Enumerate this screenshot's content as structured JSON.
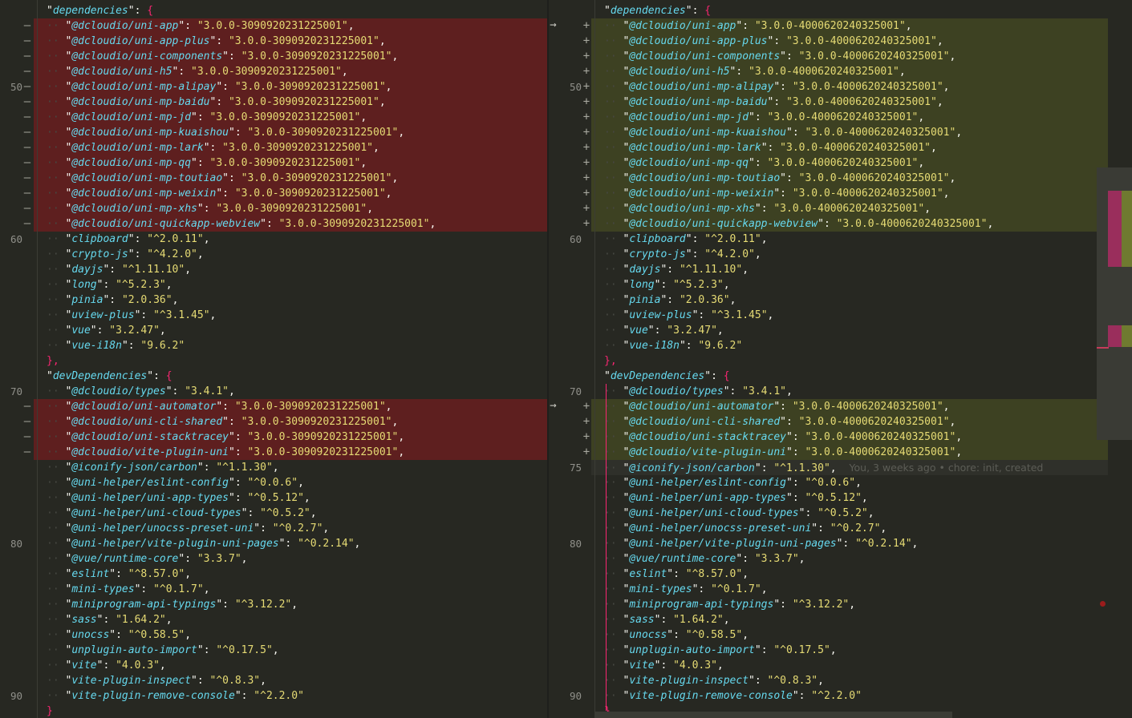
{
  "editor": {
    "colors": {
      "removed_bg": "#5e1f1f",
      "added_bg": "#3d4122",
      "key": "#66d9ef",
      "string": "#e6db74",
      "bracket": "#f92672"
    },
    "blame": "You, 3 weeks ago • chore: init, created",
    "left_lines": [
      {
        "num": "",
        "mark": "",
        "indent": 1,
        "type": "ctx",
        "key": "dependencies",
        "value": "",
        "tail": ": {",
        "brace": true
      },
      {
        "num": "",
        "mark": "—",
        "indent": 2,
        "type": "removed",
        "key": "@dcloudio/uni-app",
        "value": "3.0.0-3090920231225001",
        "tail": ","
      },
      {
        "num": "",
        "mark": "—",
        "indent": 2,
        "type": "removed",
        "key": "@dcloudio/uni-app-plus",
        "value": "3.0.0-3090920231225001",
        "tail": ","
      },
      {
        "num": "",
        "mark": "—",
        "indent": 2,
        "type": "removed",
        "key": "@dcloudio/uni-components",
        "value": "3.0.0-3090920231225001",
        "tail": ","
      },
      {
        "num": "",
        "mark": "—",
        "indent": 2,
        "type": "removed",
        "key": "@dcloudio/uni-h5",
        "value": "3.0.0-3090920231225001",
        "tail": ","
      },
      {
        "num": "50",
        "mark": "—",
        "indent": 2,
        "type": "removed",
        "key": "@dcloudio/uni-mp-alipay",
        "value": "3.0.0-3090920231225001",
        "tail": ","
      },
      {
        "num": "",
        "mark": "—",
        "indent": 2,
        "type": "removed",
        "key": "@dcloudio/uni-mp-baidu",
        "value": "3.0.0-3090920231225001",
        "tail": ","
      },
      {
        "num": "",
        "mark": "—",
        "indent": 2,
        "type": "removed",
        "key": "@dcloudio/uni-mp-jd",
        "value": "3.0.0-3090920231225001",
        "tail": ","
      },
      {
        "num": "",
        "mark": "—",
        "indent": 2,
        "type": "removed",
        "key": "@dcloudio/uni-mp-kuaishou",
        "value": "3.0.0-3090920231225001",
        "tail": ","
      },
      {
        "num": "",
        "mark": "—",
        "indent": 2,
        "type": "removed",
        "key": "@dcloudio/uni-mp-lark",
        "value": "3.0.0-3090920231225001",
        "tail": ","
      },
      {
        "num": "",
        "mark": "—",
        "indent": 2,
        "type": "removed",
        "key": "@dcloudio/uni-mp-qq",
        "value": "3.0.0-3090920231225001",
        "tail": ","
      },
      {
        "num": "",
        "mark": "—",
        "indent": 2,
        "type": "removed",
        "key": "@dcloudio/uni-mp-toutiao",
        "value": "3.0.0-3090920231225001",
        "tail": ","
      },
      {
        "num": "",
        "mark": "—",
        "indent": 2,
        "type": "removed",
        "key": "@dcloudio/uni-mp-weixin",
        "value": "3.0.0-3090920231225001",
        "tail": ","
      },
      {
        "num": "",
        "mark": "—",
        "indent": 2,
        "type": "removed",
        "key": "@dcloudio/uni-mp-xhs",
        "value": "3.0.0-3090920231225001",
        "tail": ","
      },
      {
        "num": "",
        "mark": "—",
        "indent": 2,
        "type": "removed",
        "key": "@dcloudio/uni-quickapp-webview",
        "value": "3.0.0-3090920231225001",
        "tail": ","
      },
      {
        "num": "60",
        "mark": "",
        "indent": 2,
        "type": "ctx",
        "key": "clipboard",
        "value": "^2.0.11",
        "tail": ","
      },
      {
        "num": "",
        "mark": "",
        "indent": 2,
        "type": "ctx",
        "key": "crypto-js",
        "value": "^4.2.0",
        "tail": ","
      },
      {
        "num": "",
        "mark": "",
        "indent": 2,
        "type": "ctx",
        "key": "dayjs",
        "value": "^1.11.10",
        "tail": ","
      },
      {
        "num": "",
        "mark": "",
        "indent": 2,
        "type": "ctx",
        "key": "long",
        "value": "^5.2.3",
        "tail": ","
      },
      {
        "num": "",
        "mark": "",
        "indent": 2,
        "type": "ctx",
        "key": "pinia",
        "value": "2.0.36",
        "tail": ","
      },
      {
        "num": "",
        "mark": "",
        "indent": 2,
        "type": "ctx",
        "key": "uview-plus",
        "value": "^3.1.45",
        "tail": ","
      },
      {
        "num": "",
        "mark": "",
        "indent": 2,
        "type": "ctx",
        "key": "vue",
        "value": "3.2.47",
        "tail": ","
      },
      {
        "num": "",
        "mark": "",
        "indent": 2,
        "type": "ctx",
        "key": "vue-i18n",
        "value": "9.6.2",
        "tail": ""
      },
      {
        "num": "",
        "mark": "",
        "indent": 1,
        "type": "ctx",
        "key": "",
        "value": "",
        "tail": "},",
        "close": true
      },
      {
        "num": "",
        "mark": "",
        "indent": 1,
        "type": "ctx",
        "key": "devDependencies",
        "value": "",
        "tail": ": {",
        "brace": true
      },
      {
        "num": "70",
        "mark": "",
        "indent": 2,
        "type": "ctx",
        "key": "@dcloudio/types",
        "value": "3.4.1",
        "tail": ","
      },
      {
        "num": "",
        "mark": "—",
        "indent": 2,
        "type": "removed",
        "key": "@dcloudio/uni-automator",
        "value": "3.0.0-3090920231225001",
        "tail": ","
      },
      {
        "num": "",
        "mark": "—",
        "indent": 2,
        "type": "removed",
        "key": "@dcloudio/uni-cli-shared",
        "value": "3.0.0-3090920231225001",
        "tail": ","
      },
      {
        "num": "",
        "mark": "—",
        "indent": 2,
        "type": "removed",
        "key": "@dcloudio/uni-stacktracey",
        "value": "3.0.0-3090920231225001",
        "tail": ","
      },
      {
        "num": "",
        "mark": "—",
        "indent": 2,
        "type": "removed",
        "key": "@dcloudio/vite-plugin-uni",
        "value": "3.0.0-3090920231225001",
        "tail": ","
      },
      {
        "num": "",
        "mark": "",
        "indent": 2,
        "type": "ctx",
        "key": "@iconify-json/carbon",
        "value": "^1.1.30",
        "tail": ","
      },
      {
        "num": "",
        "mark": "",
        "indent": 2,
        "type": "ctx",
        "key": "@uni-helper/eslint-config",
        "value": "^0.0.6",
        "tail": ","
      },
      {
        "num": "",
        "mark": "",
        "indent": 2,
        "type": "ctx",
        "key": "@uni-helper/uni-app-types",
        "value": "^0.5.12",
        "tail": ","
      },
      {
        "num": "",
        "mark": "",
        "indent": 2,
        "type": "ctx",
        "key": "@uni-helper/uni-cloud-types",
        "value": "^0.5.2",
        "tail": ","
      },
      {
        "num": "",
        "mark": "",
        "indent": 2,
        "type": "ctx",
        "key": "@uni-helper/unocss-preset-uni",
        "value": "^0.2.7",
        "tail": ","
      },
      {
        "num": "80",
        "mark": "",
        "indent": 2,
        "type": "ctx",
        "key": "@uni-helper/vite-plugin-uni-pages",
        "value": "^0.2.14",
        "tail": ","
      },
      {
        "num": "",
        "mark": "",
        "indent": 2,
        "type": "ctx",
        "key": "@vue/runtime-core",
        "value": "3.3.7",
        "tail": ","
      },
      {
        "num": "",
        "mark": "",
        "indent": 2,
        "type": "ctx",
        "key": "eslint",
        "value": "^8.57.0",
        "tail": ","
      },
      {
        "num": "",
        "mark": "",
        "indent": 2,
        "type": "ctx",
        "key": "mini-types",
        "value": "^0.1.7",
        "tail": ","
      },
      {
        "num": "",
        "mark": "",
        "indent": 2,
        "type": "ctx",
        "key": "miniprogram-api-typings",
        "value": "^3.12.2",
        "tail": ","
      },
      {
        "num": "",
        "mark": "",
        "indent": 2,
        "type": "ctx",
        "key": "sass",
        "value": "1.64.2",
        "tail": ","
      },
      {
        "num": "",
        "mark": "",
        "indent": 2,
        "type": "ctx",
        "key": "unocss",
        "value": "^0.58.5",
        "tail": ","
      },
      {
        "num": "",
        "mark": "",
        "indent": 2,
        "type": "ctx",
        "key": "unplugin-auto-import",
        "value": "^0.17.5",
        "tail": ","
      },
      {
        "num": "",
        "mark": "",
        "indent": 2,
        "type": "ctx",
        "key": "vite",
        "value": "4.0.3",
        "tail": ","
      },
      {
        "num": "",
        "mark": "",
        "indent": 2,
        "type": "ctx",
        "key": "vite-plugin-inspect",
        "value": "^0.8.3",
        "tail": ","
      },
      {
        "num": "90",
        "mark": "",
        "indent": 2,
        "type": "ctx",
        "key": "vite-plugin-remove-console",
        "value": "^2.2.0",
        "tail": ""
      },
      {
        "num": "",
        "mark": "",
        "indent": 1,
        "type": "ctx",
        "key": "",
        "value": "",
        "tail": "}",
        "close": true
      }
    ],
    "right_lines": [
      {
        "num": "",
        "mark": "",
        "indent": 1,
        "type": "ctx",
        "key": "dependencies",
        "value": "",
        "tail": ": {",
        "brace": true
      },
      {
        "num": "",
        "mark": "+",
        "indent": 2,
        "type": "added",
        "key": "@dcloudio/uni-app",
        "value": "3.0.0-4000620240325001",
        "tail": ","
      },
      {
        "num": "",
        "mark": "+",
        "indent": 2,
        "type": "added",
        "key": "@dcloudio/uni-app-plus",
        "value": "3.0.0-4000620240325001",
        "tail": ","
      },
      {
        "num": "",
        "mark": "+",
        "indent": 2,
        "type": "added",
        "key": "@dcloudio/uni-components",
        "value": "3.0.0-4000620240325001",
        "tail": ","
      },
      {
        "num": "",
        "mark": "+",
        "indent": 2,
        "type": "added",
        "key": "@dcloudio/uni-h5",
        "value": "3.0.0-4000620240325001",
        "tail": ","
      },
      {
        "num": "50",
        "mark": "+",
        "indent": 2,
        "type": "added",
        "key": "@dcloudio/uni-mp-alipay",
        "value": "3.0.0-4000620240325001",
        "tail": ","
      },
      {
        "num": "",
        "mark": "+",
        "indent": 2,
        "type": "added",
        "key": "@dcloudio/uni-mp-baidu",
        "value": "3.0.0-4000620240325001",
        "tail": ","
      },
      {
        "num": "",
        "mark": "+",
        "indent": 2,
        "type": "added",
        "key": "@dcloudio/uni-mp-jd",
        "value": "3.0.0-4000620240325001",
        "tail": ","
      },
      {
        "num": "",
        "mark": "+",
        "indent": 2,
        "type": "added",
        "key": "@dcloudio/uni-mp-kuaishou",
        "value": "3.0.0-4000620240325001",
        "tail": ","
      },
      {
        "num": "",
        "mark": "+",
        "indent": 2,
        "type": "added",
        "key": "@dcloudio/uni-mp-lark",
        "value": "3.0.0-4000620240325001",
        "tail": ","
      },
      {
        "num": "",
        "mark": "+",
        "indent": 2,
        "type": "added",
        "key": "@dcloudio/uni-mp-qq",
        "value": "3.0.0-4000620240325001",
        "tail": ","
      },
      {
        "num": "",
        "mark": "+",
        "indent": 2,
        "type": "added",
        "key": "@dcloudio/uni-mp-toutiao",
        "value": "3.0.0-4000620240325001",
        "tail": ","
      },
      {
        "num": "",
        "mark": "+",
        "indent": 2,
        "type": "added",
        "key": "@dcloudio/uni-mp-weixin",
        "value": "3.0.0-4000620240325001",
        "tail": ","
      },
      {
        "num": "",
        "mark": "+",
        "indent": 2,
        "type": "added",
        "key": "@dcloudio/uni-mp-xhs",
        "value": "3.0.0-4000620240325001",
        "tail": ","
      },
      {
        "num": "",
        "mark": "+",
        "indent": 2,
        "type": "added",
        "key": "@dcloudio/uni-quickapp-webview",
        "value": "3.0.0-4000620240325001",
        "tail": ","
      },
      {
        "num": "60",
        "mark": "",
        "indent": 2,
        "type": "ctx",
        "key": "clipboard",
        "value": "^2.0.11",
        "tail": ","
      },
      {
        "num": "",
        "mark": "",
        "indent": 2,
        "type": "ctx",
        "key": "crypto-js",
        "value": "^4.2.0",
        "tail": ","
      },
      {
        "num": "",
        "mark": "",
        "indent": 2,
        "type": "ctx",
        "key": "dayjs",
        "value": "^1.11.10",
        "tail": ","
      },
      {
        "num": "",
        "mark": "",
        "indent": 2,
        "type": "ctx",
        "key": "long",
        "value": "^5.2.3",
        "tail": ","
      },
      {
        "num": "",
        "mark": "",
        "indent": 2,
        "type": "ctx",
        "key": "pinia",
        "value": "2.0.36",
        "tail": ","
      },
      {
        "num": "",
        "mark": "",
        "indent": 2,
        "type": "ctx",
        "key": "uview-plus",
        "value": "^3.1.45",
        "tail": ","
      },
      {
        "num": "",
        "mark": "",
        "indent": 2,
        "type": "ctx",
        "key": "vue",
        "value": "3.2.47",
        "tail": ","
      },
      {
        "num": "",
        "mark": "",
        "indent": 2,
        "type": "ctx",
        "key": "vue-i18n",
        "value": "9.6.2",
        "tail": ""
      },
      {
        "num": "",
        "mark": "",
        "indent": 1,
        "type": "ctx",
        "key": "",
        "value": "",
        "tail": "},",
        "close": true
      },
      {
        "num": "",
        "mark": "",
        "indent": 1,
        "type": "ctx",
        "key": "devDependencies",
        "value": "",
        "tail": ": {",
        "brace": true
      },
      {
        "num": "70",
        "mark": "",
        "indent": 2,
        "type": "ctx",
        "key": "@dcloudio/types",
        "value": "3.4.1",
        "tail": ","
      },
      {
        "num": "",
        "mark": "+",
        "indent": 2,
        "type": "added",
        "key": "@dcloudio/uni-automator",
        "value": "3.0.0-4000620240325001",
        "tail": ","
      },
      {
        "num": "",
        "mark": "+",
        "indent": 2,
        "type": "added",
        "key": "@dcloudio/uni-cli-shared",
        "value": "3.0.0-4000620240325001",
        "tail": ","
      },
      {
        "num": "",
        "mark": "+",
        "indent": 2,
        "type": "added",
        "key": "@dcloudio/uni-stacktracey",
        "value": "3.0.0-4000620240325001",
        "tail": ","
      },
      {
        "num": "",
        "mark": "+",
        "indent": 2,
        "type": "added",
        "key": "@dcloudio/vite-plugin-uni",
        "value": "3.0.0-4000620240325001",
        "tail": ","
      },
      {
        "num": "75",
        "mark": "",
        "indent": 2,
        "type": "cursor",
        "key": "@iconify-json/carbon",
        "value": "^1.1.30",
        "tail": ",",
        "blame": true
      },
      {
        "num": "",
        "mark": "",
        "indent": 2,
        "type": "ctx",
        "key": "@uni-helper/eslint-config",
        "value": "^0.0.6",
        "tail": ","
      },
      {
        "num": "",
        "mark": "",
        "indent": 2,
        "type": "ctx",
        "key": "@uni-helper/uni-app-types",
        "value": "^0.5.12",
        "tail": ","
      },
      {
        "num": "",
        "mark": "",
        "indent": 2,
        "type": "ctx",
        "key": "@uni-helper/uni-cloud-types",
        "value": "^0.5.2",
        "tail": ","
      },
      {
        "num": "",
        "mark": "",
        "indent": 2,
        "type": "ctx",
        "key": "@uni-helper/unocss-preset-uni",
        "value": "^0.2.7",
        "tail": ","
      },
      {
        "num": "80",
        "mark": "",
        "indent": 2,
        "type": "ctx",
        "key": "@uni-helper/vite-plugin-uni-pages",
        "value": "^0.2.14",
        "tail": ","
      },
      {
        "num": "",
        "mark": "",
        "indent": 2,
        "type": "ctx",
        "key": "@vue/runtime-core",
        "value": "3.3.7",
        "tail": ","
      },
      {
        "num": "",
        "mark": "",
        "indent": 2,
        "type": "ctx",
        "key": "eslint",
        "value": "^8.57.0",
        "tail": ","
      },
      {
        "num": "",
        "mark": "",
        "indent": 2,
        "type": "ctx",
        "key": "mini-types",
        "value": "^0.1.7",
        "tail": ","
      },
      {
        "num": "",
        "mark": "",
        "indent": 2,
        "type": "ctx",
        "key": "miniprogram-api-typings",
        "value": "^3.12.2",
        "tail": ","
      },
      {
        "num": "",
        "mark": "",
        "indent": 2,
        "type": "ctx",
        "key": "sass",
        "value": "1.64.2",
        "tail": ","
      },
      {
        "num": "",
        "mark": "",
        "indent": 2,
        "type": "ctx",
        "key": "unocss",
        "value": "^0.58.5",
        "tail": ","
      },
      {
        "num": "",
        "mark": "",
        "indent": 2,
        "type": "ctx",
        "key": "unplugin-auto-import",
        "value": "^0.17.5",
        "tail": ","
      },
      {
        "num": "",
        "mark": "",
        "indent": 2,
        "type": "ctx",
        "key": "vite",
        "value": "4.0.3",
        "tail": ","
      },
      {
        "num": "",
        "mark": "",
        "indent": 2,
        "type": "ctx",
        "key": "vite-plugin-inspect",
        "value": "^0.8.3",
        "tail": ","
      },
      {
        "num": "90",
        "mark": "",
        "indent": 2,
        "type": "ctx",
        "key": "vite-plugin-remove-console",
        "value": "^2.2.0",
        "tail": ""
      },
      {
        "num": "",
        "mark": "",
        "indent": 1,
        "type": "ctx",
        "key": "",
        "value": "",
        "tail": "}",
        "close": true
      }
    ]
  }
}
